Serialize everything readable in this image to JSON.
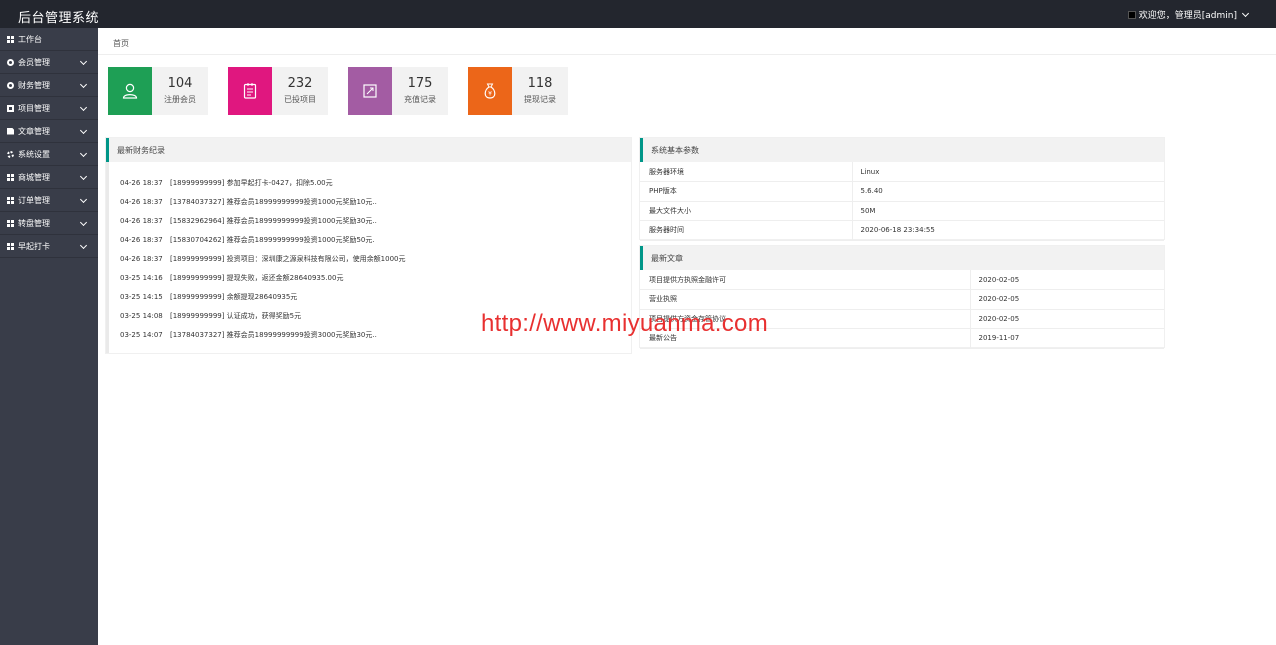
{
  "app": {
    "title": "后台管理系统"
  },
  "user": {
    "greeting": "欢迎您，管理员[admin]"
  },
  "sidebar": {
    "items": [
      {
        "label": "工作台",
        "icon": "dashboard-icon",
        "expandable": false
      },
      {
        "label": "会员管理",
        "icon": "member-icon",
        "expandable": true
      },
      {
        "label": "财务管理",
        "icon": "finance-icon",
        "expandable": true
      },
      {
        "label": "项目管理",
        "icon": "project-icon",
        "expandable": true
      },
      {
        "label": "文章管理",
        "icon": "article-icon",
        "expandable": true
      },
      {
        "label": "系统设置",
        "icon": "settings-icon",
        "expandable": true
      },
      {
        "label": "商城管理",
        "icon": "mall-icon",
        "expandable": true
      },
      {
        "label": "订单管理",
        "icon": "order-icon",
        "expandable": true
      },
      {
        "label": "转盘管理",
        "icon": "wheel-icon",
        "expandable": true
      },
      {
        "label": "早起打卡",
        "icon": "checkin-icon",
        "expandable": true
      }
    ]
  },
  "breadcrumb": {
    "home": "首页"
  },
  "stats": [
    {
      "value": "104",
      "label": "注册会员",
      "color": "#1e9f55",
      "icon": "user-icon"
    },
    {
      "value": "232",
      "label": "已投项目",
      "color": "#e0177f",
      "icon": "clipboard-icon"
    },
    {
      "value": "175",
      "label": "充值记录",
      "color": "#a35ca3",
      "icon": "recharge-icon"
    },
    {
      "value": "118",
      "label": "提现记录",
      "color": "#ec6619",
      "icon": "money-bag-icon"
    }
  ],
  "finance_panel": {
    "title": "最新财务纪录",
    "rows": [
      {
        "time": "04-26 18:37",
        "text": "[18999999999] 参加早起打卡-0427，扣除5.00元"
      },
      {
        "time": "04-26 18:37",
        "text": "[13784037327] 推荐会员18999999999投资1000元奖励10元.."
      },
      {
        "time": "04-26 18:37",
        "text": "[15832962964] 推荐会员18999999999投资1000元奖励30元.."
      },
      {
        "time": "04-26 18:37",
        "text": "[15830704262] 推荐会员18999999999投资1000元奖励50元."
      },
      {
        "time": "04-26 18:37",
        "text": "[18999999999] 投资项目：深圳康之源泉科技有限公司，使用余额1000元"
      },
      {
        "time": "03-25 14:16",
        "text": "[18999999999] 提现失败，返还金额28640935.00元"
      },
      {
        "time": "03-25 14:15",
        "text": "[18999999999] 余额提现28640935元"
      },
      {
        "time": "03-25 14:08",
        "text": "[18999999999] 认证成功，获得奖励5元"
      },
      {
        "time": "03-25 14:07",
        "text": "[13784037327] 推荐会员18999999999投资3000元奖励30元.."
      }
    ]
  },
  "system_panel": {
    "title": "系统基本参数",
    "rows": [
      {
        "key": "服务器环境",
        "value": "Linux"
      },
      {
        "key": "PHP版本",
        "value": "5.6.40"
      },
      {
        "key": "最大文件大小",
        "value": "50M"
      },
      {
        "key": "服务器时间",
        "value": "2020-06-18 23:34:55"
      }
    ]
  },
  "articles_panel": {
    "title": "最新文章",
    "rows": [
      {
        "title": "项目提供方执照金融许可",
        "date": "2020-02-05"
      },
      {
        "title": "营业执照",
        "date": "2020-02-05"
      },
      {
        "title": "项目提供方资金存管协议",
        "date": "2020-02-05"
      },
      {
        "title": "最新公告",
        "date": "2019-11-07"
      }
    ]
  },
  "watermark": "http://www.miyuanma.com"
}
